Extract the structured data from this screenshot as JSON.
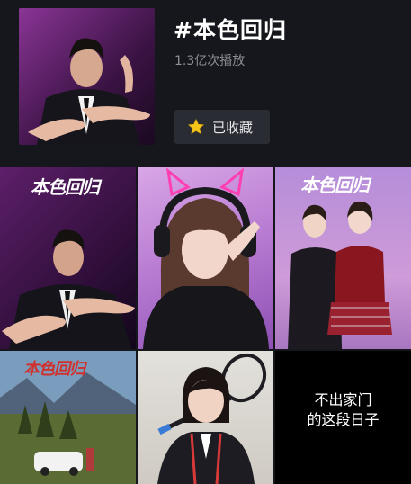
{
  "header": {
    "title": "#本色回归",
    "plays": "1.3亿次播放",
    "favorite_label": "已收藏"
  },
  "grid": {
    "cells": [
      {
        "overlay": "本色回归"
      },
      {
        "overlay": ""
      },
      {
        "overlay": "本色回归"
      },
      {
        "overlay": "本色回归"
      },
      {
        "overlay": ""
      },
      {
        "text_line1": "不出家门",
        "text_line2": "的这段日子"
      }
    ]
  },
  "colors": {
    "background": "#16171c",
    "button_bg": "#2a2c33",
    "star": "#f5c518",
    "secondary_text": "#8d8f96",
    "brush_red": "#d0312d"
  },
  "icons": {
    "favorite": "star-icon"
  }
}
